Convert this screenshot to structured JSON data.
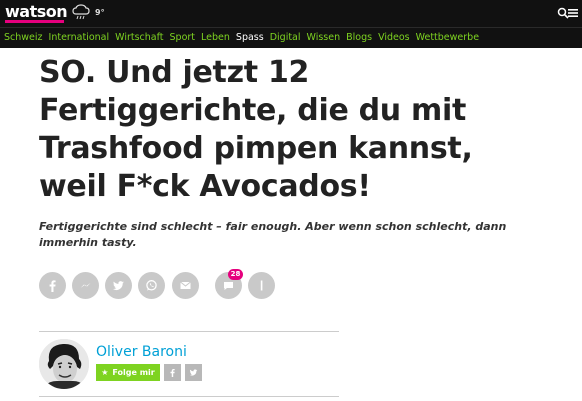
{
  "header": {
    "logo": "watson",
    "weather_icon": "weather-icon",
    "temperature": "9°",
    "search_icon": "search-icon",
    "menu_icon": "menu-icon",
    "accent": "#e6007e"
  },
  "nav": {
    "items": [
      {
        "label": "Schweiz"
      },
      {
        "label": "International"
      },
      {
        "label": "Wirtschaft"
      },
      {
        "label": "Sport"
      },
      {
        "label": "Leben"
      },
      {
        "label": "Spass"
      },
      {
        "label": "Digital"
      },
      {
        "label": "Wissen"
      },
      {
        "label": "Blogs"
      },
      {
        "label": "Videos"
      },
      {
        "label": "Wettbewerbe"
      }
    ],
    "active": "Spass",
    "color": "#7ed321"
  },
  "article": {
    "headline": "SO. Und jetzt 12 Fertiggerichte, die du mit Trashfood pimpen kannst, weil F*ck Avocados!",
    "lead": "Fertiggerichte sind schlecht – fair enough. Aber wenn schon schlecht, dann immerhin tasty.",
    "share": {
      "buttons": [
        "facebook-icon",
        "messenger-icon",
        "twitter-icon",
        "whatsapp-icon",
        "mail-icon",
        "comment-icon",
        "more-icon"
      ],
      "comment_count": "28"
    },
    "author": {
      "name": "Oliver Baroni",
      "follow_label": "Folge mir",
      "social": [
        "facebook-icon",
        "twitter-icon"
      ]
    }
  }
}
